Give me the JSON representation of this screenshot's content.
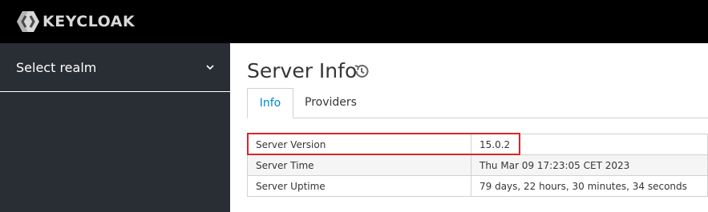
{
  "header": {
    "brand": "KEYCLOAK"
  },
  "sidebar": {
    "realm_select_label": "Select realm"
  },
  "main": {
    "title": "Server Info",
    "tabs": [
      {
        "label": "Info"
      },
      {
        "label": "Providers"
      }
    ],
    "rows": [
      {
        "key": "Server Version",
        "value": "15.0.2"
      },
      {
        "key": "Server Time",
        "value": "Thu Mar 09 17:23:05 CET 2023"
      },
      {
        "key": "Server Uptime",
        "value": "79 days, 22 hours, 30 minutes, 34 seconds"
      }
    ]
  },
  "colors": {
    "topbar": "#000000",
    "sidebar": "#292e34",
    "active_tab": "#0088ce",
    "highlight": "#d9262c"
  },
  "icons": {
    "logo": "keycloak-logo-icon",
    "realm_dropdown": "chevron-down-icon",
    "history": "history-icon"
  }
}
